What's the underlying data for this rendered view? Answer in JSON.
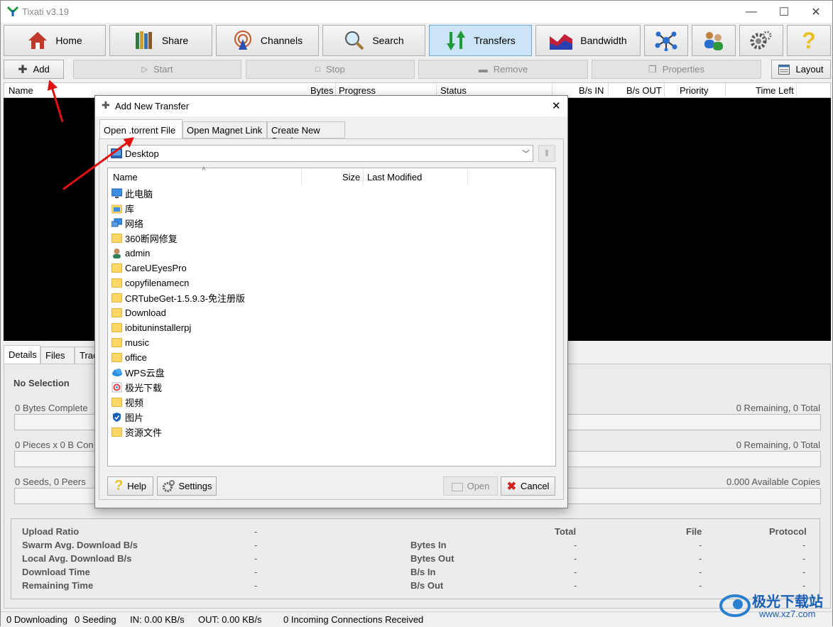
{
  "app": {
    "title": "Tixati v3.19"
  },
  "window_controls": {
    "minimize": "—",
    "maximize": "☐",
    "close": "✕"
  },
  "nav": {
    "home": "Home",
    "share": "Share",
    "channels": "Channels",
    "search": "Search",
    "transfers": "Transfers",
    "bandwidth": "Bandwidth",
    "help_glyph": "?"
  },
  "toolbar": {
    "add": "Add",
    "start": "Start",
    "stop": "Stop",
    "remove": "Remove",
    "properties": "Properties",
    "layout": "Layout"
  },
  "transfer_columns": {
    "name": "Name",
    "bytes": "Bytes",
    "progress": "Progress",
    "status": "Status",
    "bs_in": "B/s IN",
    "bs_out": "B/s OUT",
    "priority": "Priority",
    "time_left": "Time Left"
  },
  "detail_tabs": {
    "details": "Details",
    "files": "Files",
    "trackers": "Trac"
  },
  "details": {
    "no_selection": "No Selection",
    "bytes_complete": "0 Bytes Complete",
    "bytes_remaining": "0 Remaining,  0 Total",
    "pieces": "0 Pieces  x  0 B Con",
    "pieces_remaining": "0 Remaining,  0 Total",
    "seeds_peers": "0 Seeds, 0 Peers",
    "available_copies": "0.000 Available Copies"
  },
  "stats": {
    "labels_left": [
      "Upload Ratio",
      "Swarm Avg. Download B/s",
      "Local Avg. Download B/s",
      "Download Time",
      "Remaining Time"
    ],
    "labels_mid": [
      "Bytes In",
      "Bytes Out",
      "B/s In",
      "B/s Out"
    ],
    "headers": {
      "total": "Total",
      "file": "File",
      "protocol": "Protocol"
    },
    "dash": "-"
  },
  "statusbar": {
    "downloading": "0 Downloading",
    "seeding": "0 Seeding",
    "in": "IN: 0.00 KB/s",
    "out": "OUT: 0.00 KB/s",
    "connections": "0 Incoming Connections Received"
  },
  "dialog": {
    "title": "Add New Transfer",
    "close": "✕",
    "tabs": [
      "Open .torrent File",
      "Open Magnet Link",
      "Create New Seed"
    ],
    "location": "Desktop",
    "columns": {
      "name": "Name",
      "size": "Size",
      "modified": "Last Modified"
    },
    "files": [
      {
        "name": "此电脑",
        "icon": "computer-icon"
      },
      {
        "name": "库",
        "icon": "library-icon"
      },
      {
        "name": "网络",
        "icon": "network-icon"
      },
      {
        "name": "360断网修复",
        "icon": "folder-icon"
      },
      {
        "name": "admin",
        "icon": "user-icon"
      },
      {
        "name": "CareUEyesPro",
        "icon": "folder-icon"
      },
      {
        "name": "copyfilenamecn",
        "icon": "folder-icon"
      },
      {
        "name": "CRTubeGet-1.5.9.3-免注册版",
        "icon": "folder-icon"
      },
      {
        "name": "Download",
        "icon": "folder-icon"
      },
      {
        "name": "iobituninstallerpj",
        "icon": "folder-icon"
      },
      {
        "name": "music",
        "icon": "folder-icon"
      },
      {
        "name": "office",
        "icon": "folder-icon"
      },
      {
        "name": "WPS云盘",
        "icon": "cloud-icon"
      },
      {
        "name": "极光下载",
        "icon": "app-icon"
      },
      {
        "name": "视频",
        "icon": "folder-icon"
      },
      {
        "name": "图片",
        "icon": "shield-icon"
      },
      {
        "name": "资源文件",
        "icon": "folder-icon"
      }
    ],
    "buttons": {
      "help": "Help",
      "settings": "Settings",
      "open": "Open",
      "cancel": "Cancel"
    }
  },
  "watermark": {
    "brand": "极光下载站",
    "url": "www.xz7.com"
  },
  "colors": {
    "active_tab_bg": "#cce4f7",
    "annotation_arrow": "#e01010"
  }
}
